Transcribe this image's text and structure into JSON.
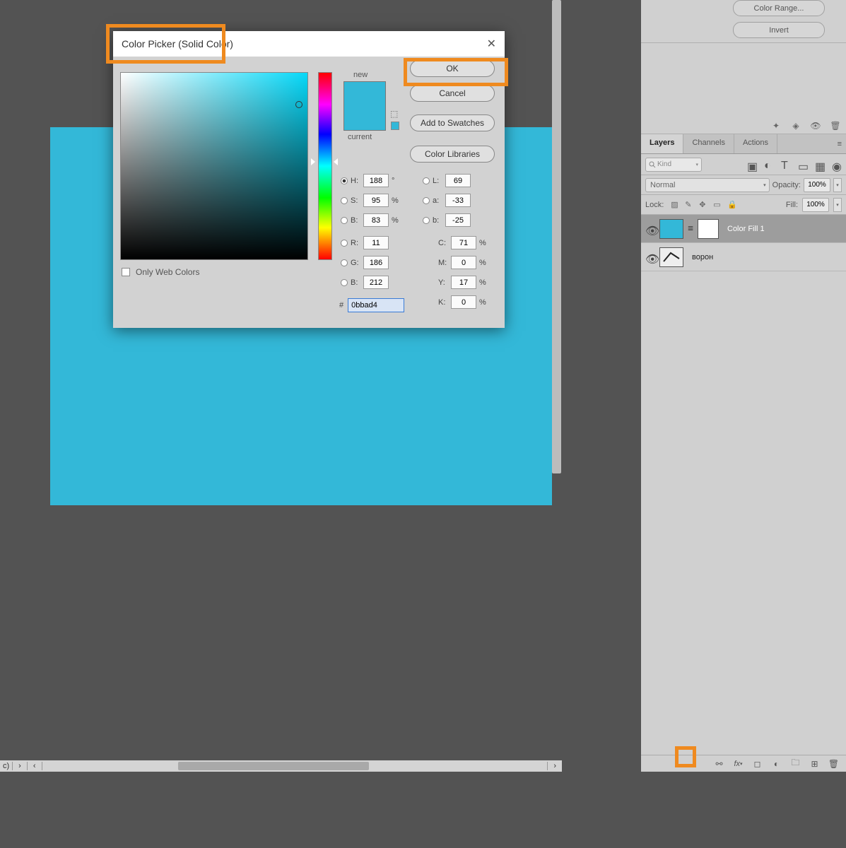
{
  "dialog": {
    "title": "Color Picker (Solid Color)",
    "buttons": {
      "ok": "OK",
      "cancel": "Cancel",
      "swatches": "Add to Swatches",
      "libraries": "Color Libraries"
    },
    "swatch_labels": {
      "new": "new",
      "current": "current"
    },
    "only_web_colors": "Only Web Colors",
    "fields": {
      "H": {
        "label": "H:",
        "value": "188",
        "unit": "°"
      },
      "S": {
        "label": "S:",
        "value": "95",
        "unit": "%"
      },
      "Bv": {
        "label": "B:",
        "value": "83",
        "unit": "%"
      },
      "R": {
        "label": "R:",
        "value": "11",
        "unit": ""
      },
      "G": {
        "label": "G:",
        "value": "186",
        "unit": ""
      },
      "Bc": {
        "label": "B:",
        "value": "212",
        "unit": ""
      },
      "L": {
        "label": "L:",
        "value": "69",
        "unit": ""
      },
      "a": {
        "label": "a:",
        "value": "-33",
        "unit": ""
      },
      "b": {
        "label": "b:",
        "value": "-25",
        "unit": ""
      },
      "C": {
        "label": "C:",
        "value": "71",
        "unit": "%"
      },
      "M": {
        "label": "M:",
        "value": "0",
        "unit": "%"
      },
      "Y": {
        "label": "Y:",
        "value": "17",
        "unit": "%"
      },
      "K": {
        "label": "K:",
        "value": "0",
        "unit": "%"
      }
    },
    "hex": {
      "label": "#",
      "value": "0bbad4"
    },
    "selected_color": "#33b8d8"
  },
  "right_panel": {
    "top_buttons": {
      "color_range": "Color Range...",
      "invert": "Invert"
    },
    "tabs": {
      "layers": "Layers",
      "channels": "Channels",
      "actions": "Actions"
    },
    "filter": {
      "kind_placeholder": "Kind"
    },
    "blend": {
      "mode": "Normal",
      "opacity_label": "Opacity:",
      "opacity": "100%"
    },
    "lock": {
      "label": "Lock:",
      "fill_label": "Fill:",
      "fill": "100%"
    },
    "layers": [
      {
        "name": "Color Fill 1"
      },
      {
        "name": "ворон"
      }
    ],
    "bottom_fx_label": "fx"
  },
  "status_bar": {
    "left": "c)",
    "arrow": "›",
    "arrow_l": "‹",
    "arrow_r": "›"
  }
}
